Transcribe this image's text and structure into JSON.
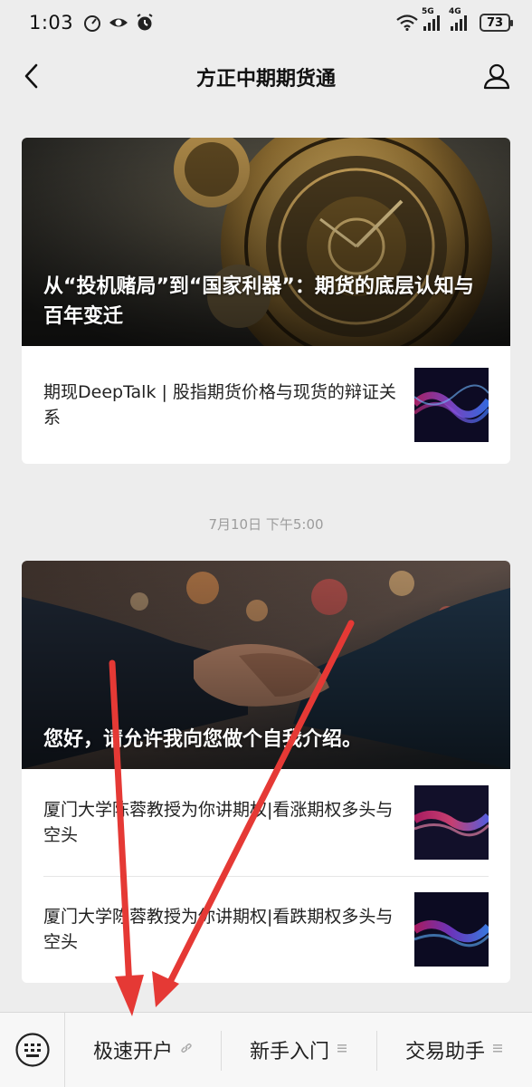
{
  "status_bar": {
    "time": "1:03",
    "signal_5g": "5G",
    "signal_4g": "4G",
    "battery": "73"
  },
  "nav": {
    "title": "方正中期期货通"
  },
  "feed": [
    {
      "hero_title": "从“投机赌局”到“国家利器”：期货的底层认知与百年变迁",
      "items": [
        {
          "title": "期现DeepTalk | 股指期货价格与现货的辩证关系"
        }
      ]
    },
    {
      "timestamp": "7月10日 下午5:00",
      "hero_title": "您好，请允许我向您做个自我介绍。",
      "items": [
        {
          "title": "厦门大学陈蓉教授为你讲期权|看涨期权多头与空头"
        },
        {
          "title": "厦门大学陈蓉教授为你讲期权|看跌期权多头与空头"
        }
      ]
    }
  ],
  "bottom_menu": {
    "items": [
      {
        "label": "极速开户",
        "icon": "link-icon"
      },
      {
        "label": "新手入门",
        "icon": "menu-icon"
      },
      {
        "label": "交易助手",
        "icon": "menu-icon"
      }
    ]
  },
  "colors": {
    "background": "#ededed",
    "annotation_arrow": "#e53935"
  }
}
